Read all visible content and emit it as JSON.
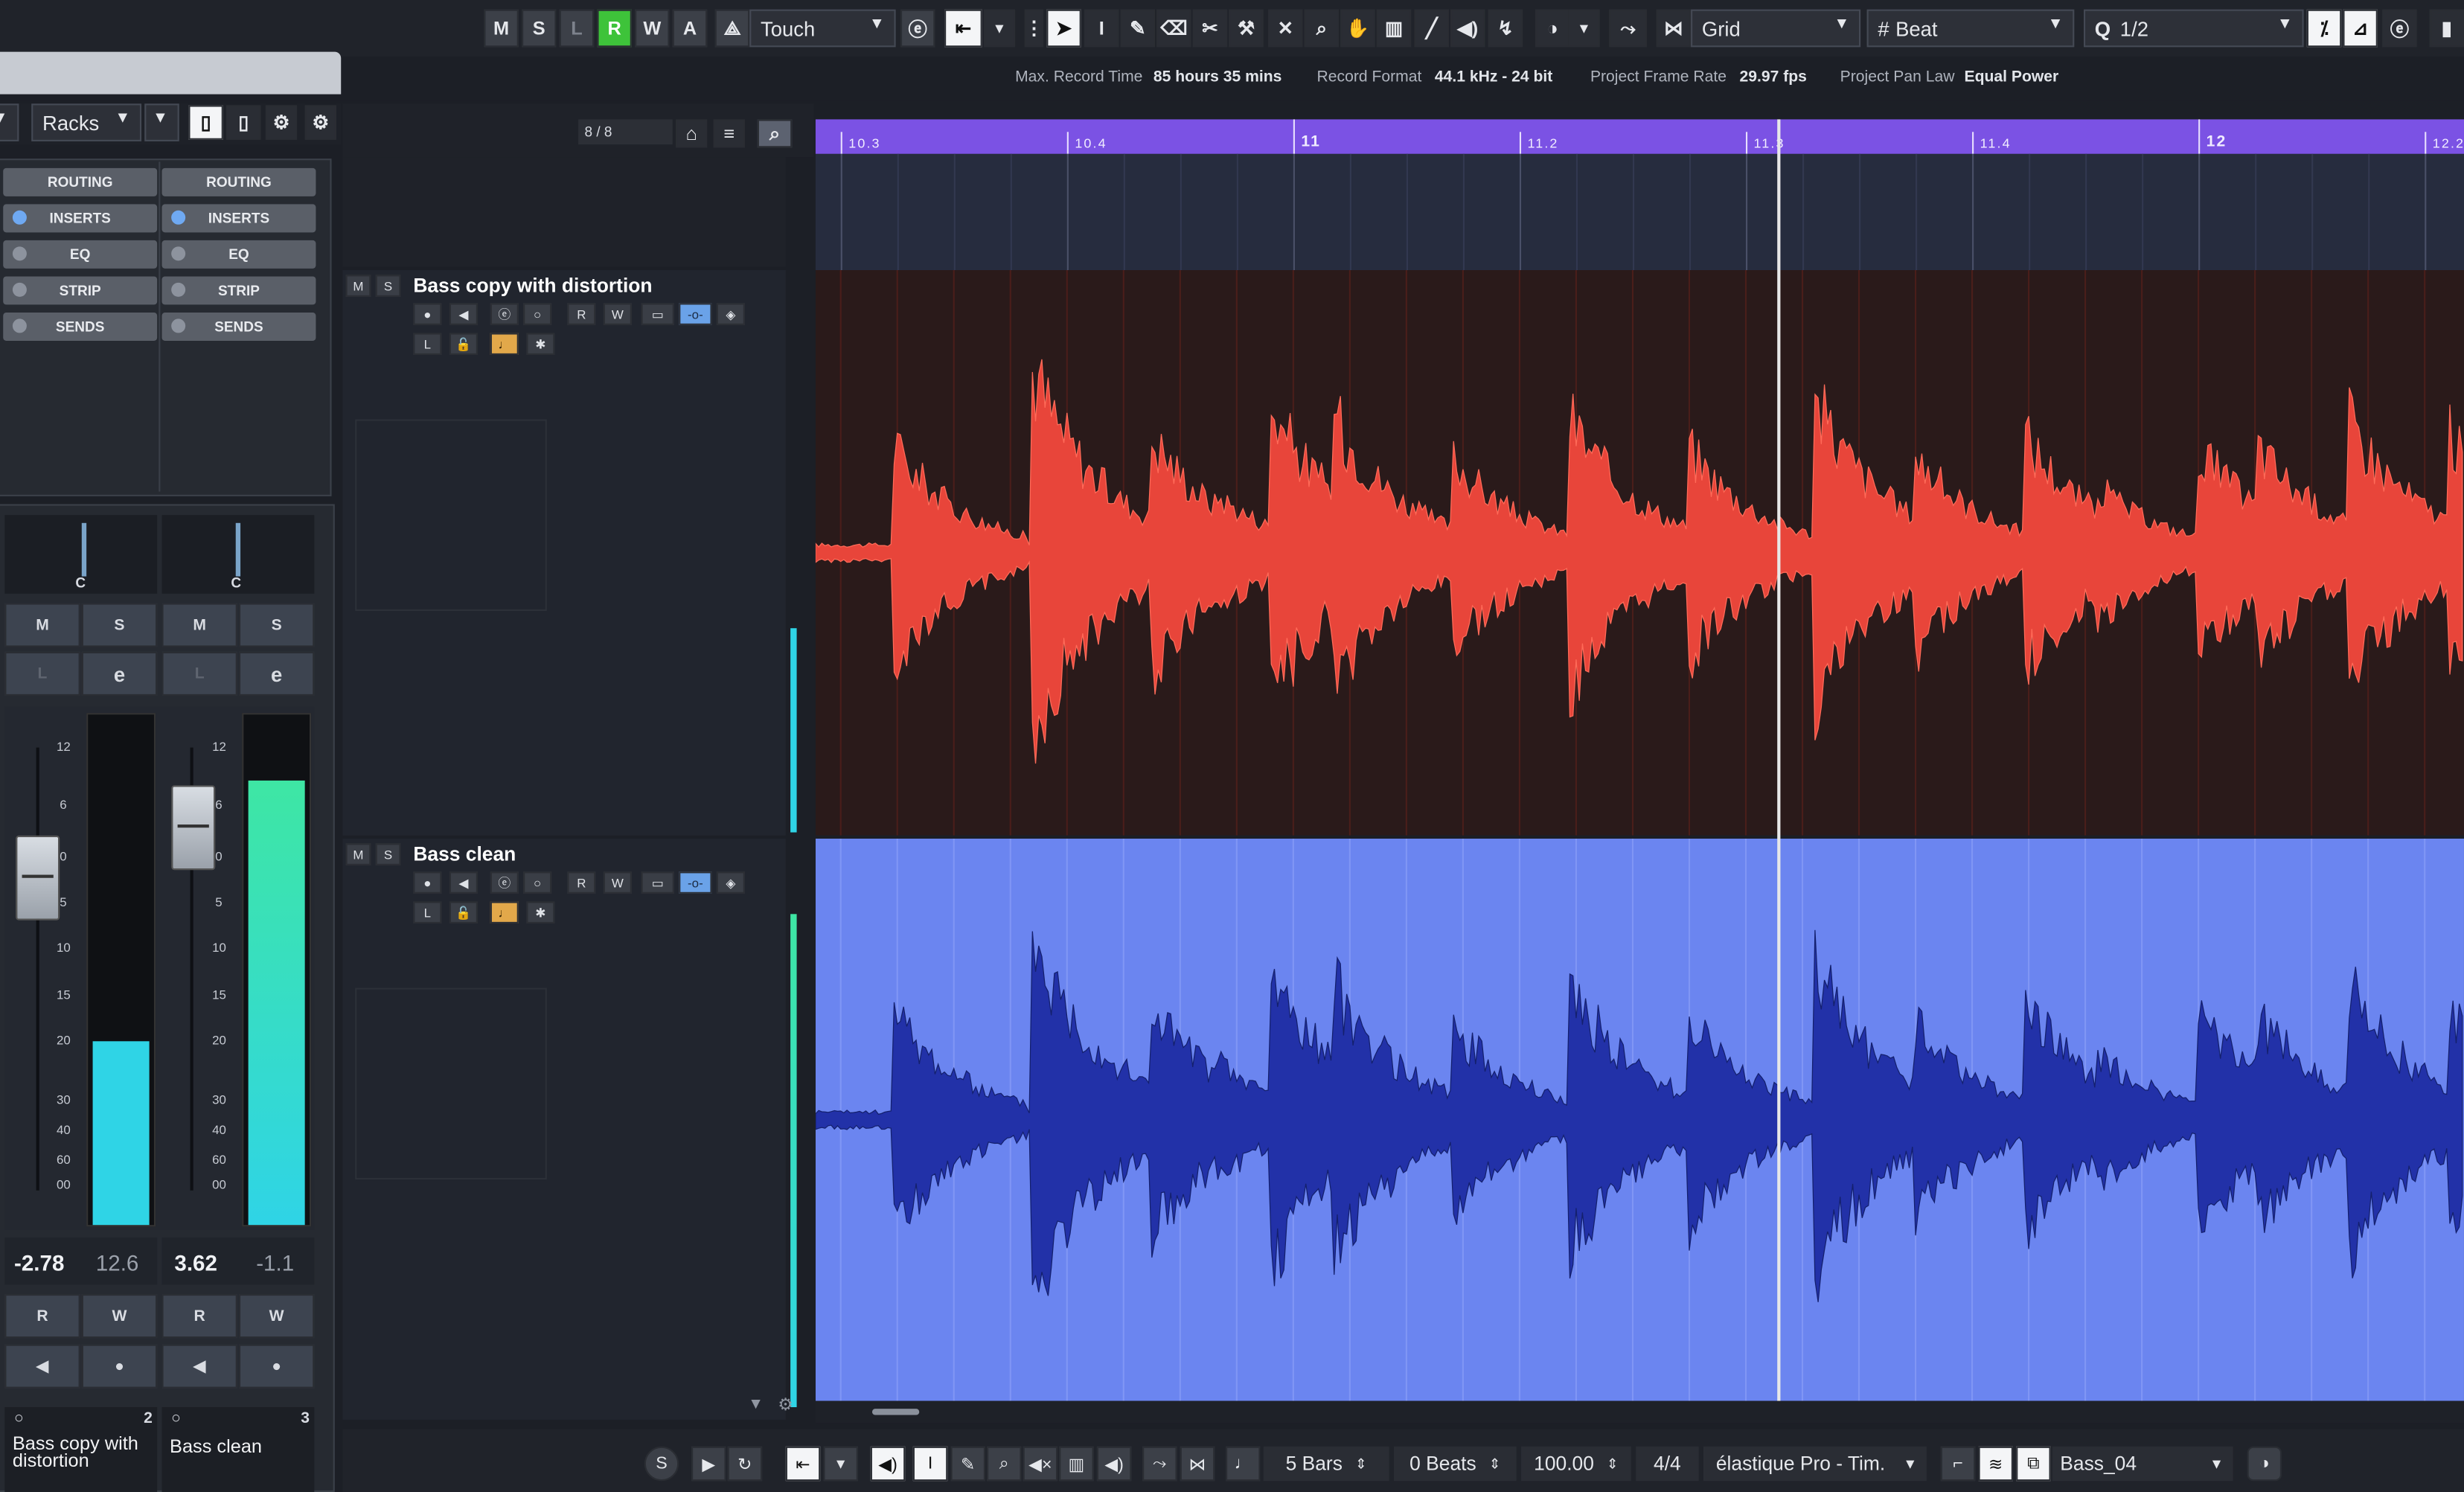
{
  "toolbar": {
    "m": "M",
    "s": "S",
    "l": "L",
    "r": "R",
    "w": "W",
    "a": "A",
    "automation_mode": "Touch",
    "snap_type": "Grid",
    "grid_type": "Beat",
    "quantize": "1/2",
    "accent_green": "#3ec33a"
  },
  "info_line": {
    "max_record_label": "Max. Record Time",
    "max_record_value": "85 hours 35 mins",
    "record_format_label": "Record Format",
    "record_format_value": "44.1 kHz - 24 bit",
    "frame_rate_label": "Project Frame Rate",
    "frame_rate_value": "29.97 fps",
    "pan_law_label": "Project Pan Law",
    "pan_law_value": "Equal Power"
  },
  "mixer": {
    "racks_label": "Racks",
    "track_count": "8 / 8",
    "rack_buttons": [
      "ROUTING",
      "INSERTS",
      "EQ",
      "STRIP",
      "SENDS"
    ],
    "channels": [
      {
        "pan": "C",
        "mute": "M",
        "solo": "S",
        "listen": "L",
        "edit": "e",
        "level": "-2.78",
        "peak": "12.6",
        "read": "R",
        "write": "W",
        "number": "2",
        "name": "Bass copy with distortion",
        "meter_fraction": 0.36,
        "fader_db": 0
      },
      {
        "pan": "C",
        "mute": "M",
        "solo": "S",
        "listen": "L",
        "edit": "e",
        "level": "3.62",
        "peak": "-1.1",
        "read": "R",
        "write": "W",
        "number": "3",
        "name": "Bass clean",
        "meter_fraction": 0.87,
        "fader_db": 3.62
      }
    ],
    "fader_scale": [
      "12",
      "6",
      "0",
      "5",
      "10",
      "15",
      "20",
      "30",
      "40",
      "60",
      "00"
    ]
  },
  "tracks": [
    {
      "name": "Bass copy with distortion",
      "color": "#e8453a",
      "bg": "#2a1a1a"
    },
    {
      "name": "Bass clean",
      "color": "#6b85f0",
      "wave": "#2231a8"
    }
  ],
  "ruler": {
    "labels": [
      "10.3",
      "10.4",
      "11",
      "11.2",
      "11.3",
      "11.4",
      "12",
      "12.2"
    ],
    "bars": [
      "11",
      "12"
    ],
    "color": "#7b52e4"
  },
  "transport": {
    "length": "5 Bars",
    "beats": "0 Beats",
    "tempo": "100.00",
    "signature": "4/4",
    "algorithm": "élastique Pro - Tim.",
    "clip_name": "Bass_04"
  }
}
